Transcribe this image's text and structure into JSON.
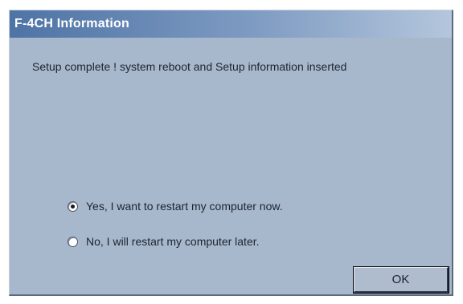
{
  "window": {
    "title": "F-4CH Information"
  },
  "message": "Setup complete ! system reboot and Setup information inserted",
  "options": [
    {
      "label": "Yes, I want to restart my computer now.",
      "selected": true
    },
    {
      "label": "No, I will restart my computer later.",
      "selected": false
    }
  ],
  "buttons": {
    "ok_label": "OK"
  },
  "colors": {
    "dialog_background": "#a8b8cc",
    "titlebar_start": "#4e73a5",
    "titlebar_end": "#b4c6dc",
    "title_text": "#ffffff"
  }
}
